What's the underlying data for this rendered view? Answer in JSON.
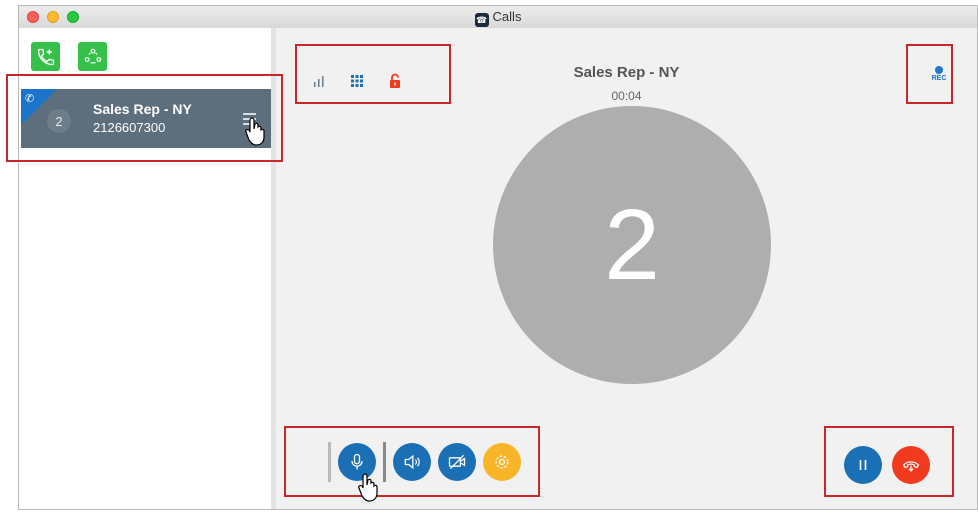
{
  "window": {
    "title": "Calls"
  },
  "sidebar": {
    "new_call_icon": "phone-plus-icon",
    "conference_icon": "conference-icon",
    "call": {
      "badge_number": "2",
      "name": "Sales Rep - NY",
      "number": "2126607300"
    }
  },
  "main": {
    "call_name": "Sales Rep - NY",
    "timer": "00:04",
    "rec_label": "REC",
    "avatar_number": "2"
  },
  "colors": {
    "green": "#35c04a",
    "blue": "#1a6fb5",
    "red": "#f23b1e",
    "yellow": "#f7b52a",
    "annotation": "#c8262a"
  }
}
